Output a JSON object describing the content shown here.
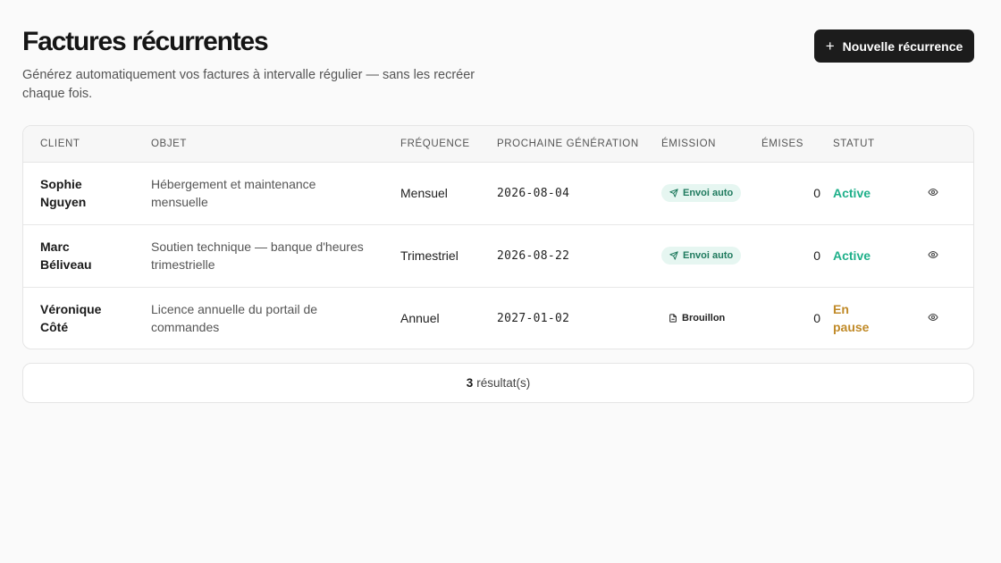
{
  "header": {
    "title": "Factures récurrentes",
    "subtitle": "Générez automatiquement vos factures à intervalle régulier — sans les recréer chaque fois.",
    "new_button": "Nouvelle récurrence"
  },
  "table": {
    "columns": [
      "CLIENT",
      "OBJET",
      "FRÉQUENCE",
      "PROCHAINE GÉNÉRATION",
      "ÉMISSION",
      "ÉMISES",
      "STATUT"
    ],
    "rows": [
      {
        "client": "Sophie Nguyen",
        "object": "Hébergement et maintenance mensuelle",
        "frequency": "Mensuel",
        "next": "2026-08-04",
        "emission": "Envoi auto",
        "emission_type": "auto",
        "issued": "0",
        "status": "Active",
        "status_type": "active"
      },
      {
        "client": "Marc Béliveau",
        "object": "Soutien technique — banque d'heures trimestrielle",
        "frequency": "Trimestriel",
        "next": "2026-08-22",
        "emission": "Envoi auto",
        "emission_type": "auto",
        "issued": "0",
        "status": "Active",
        "status_type": "active"
      },
      {
        "client": "Véronique Côté",
        "object": "Licence annuelle du portail de commandes",
        "frequency": "Annuel",
        "next": "2027-01-02",
        "emission": "Brouillon",
        "emission_type": "draft",
        "issued": "0",
        "status": "En pause",
        "status_type": "paused"
      }
    ]
  },
  "footer": {
    "count": "3",
    "label": "résultat(s)"
  },
  "colors": {
    "active": "#1fb08a",
    "paused": "#c08a28",
    "auto_badge_bg": "#e6f6f1",
    "button_bg": "#1c1c1c"
  }
}
